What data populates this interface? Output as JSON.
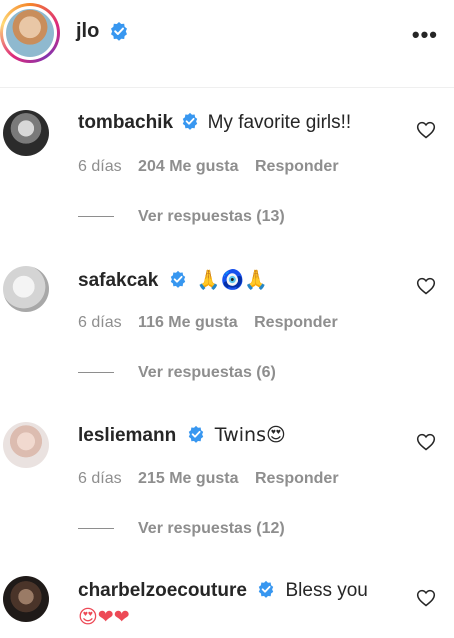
{
  "header": {
    "username": "jlo",
    "more_label": "•••"
  },
  "comments": [
    {
      "username": "tombachik",
      "text": "My favorite girls!! ",
      "time": "6 días",
      "likes": "204 Me gusta",
      "reply_label": "Responder",
      "view_replies": "Ver respuestas (13)"
    },
    {
      "username": "safakcak",
      "text": "🙏🧿🙏",
      "time": "6 días",
      "likes": "116 Me gusta",
      "reply_label": "Responder",
      "view_replies": "Ver respuestas (6)"
    },
    {
      "username": "lesliemann",
      "text": "Twins😍",
      "time": "6 días",
      "likes": "215 Me gusta",
      "reply_label": "Responder",
      "view_replies": "Ver respuestas (12)"
    },
    {
      "username": "charbelzoecouture",
      "text": "Bless you",
      "text_line2": "😍❤❤"
    }
  ],
  "colors": {
    "verified": "#3897f0",
    "muted": "#8e8e8e",
    "text": "#262626",
    "heart_red": "#ed4956"
  }
}
